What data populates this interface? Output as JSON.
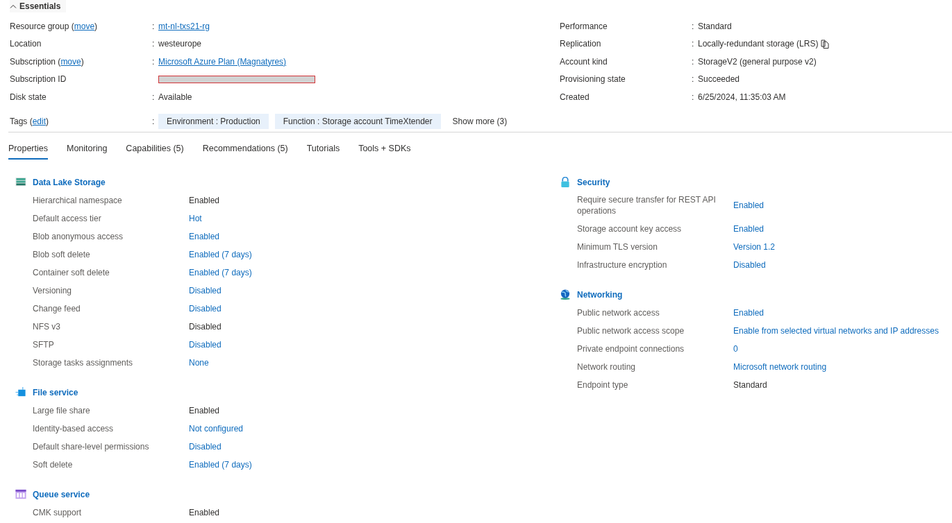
{
  "essentials": {
    "title": "Essentials",
    "expanded": true,
    "left": [
      {
        "label": "Resource group (",
        "label_link": "move",
        "label_after": ")",
        "separator": ":",
        "value": "mt-nl-txs21-rg",
        "link": true
      },
      {
        "label": "Location",
        "separator": ":",
        "value": "westeurope",
        "link": false
      },
      {
        "label": "Subscription (",
        "label_link": "move",
        "label_after": ")",
        "separator": ":",
        "value": "Microsoft Azure Plan (Magnatyres)",
        "link": true
      },
      {
        "label": "Subscription ID",
        "kind": "redacted"
      },
      {
        "label": "Disk state",
        "separator": ":",
        "value": "Available",
        "link": false
      }
    ],
    "right": [
      {
        "label": "Performance",
        "separator": ":",
        "value": "Standard",
        "link": false
      },
      {
        "label": "Replication",
        "separator": ":",
        "value": "Locally-redundant storage (LRS)",
        "link": false,
        "copyable": true
      },
      {
        "label": "Account kind",
        "separator": ":",
        "value": "StorageV2 (general purpose v2)",
        "link": false
      },
      {
        "label": "Provisioning state",
        "separator": ":",
        "value": "Succeeded",
        "link": false
      },
      {
        "label": "Created",
        "separator": ":",
        "value": "6/25/2024, 11:35:03 AM",
        "link": false
      }
    ],
    "tags": {
      "label": "Tags (",
      "label_link": "edit",
      "label_after": ")",
      "separator": ":",
      "items": [
        "Environment : Production",
        "Function : Storage account TimeXtender"
      ],
      "show_more": "Show more (3)"
    }
  },
  "tabs": [
    {
      "label": "Properties",
      "selected": true
    },
    {
      "label": "Monitoring",
      "selected": false
    },
    {
      "label": "Capabilities (5)",
      "selected": false
    },
    {
      "label": "Recommendations (5)",
      "selected": false
    },
    {
      "label": "Tutorials",
      "selected": false
    },
    {
      "label": "Tools + SDKs",
      "selected": false
    }
  ],
  "columns": [
    [
      {
        "title": "Data Lake Storage",
        "items": [
          {
            "label": "Hierarchical namespace",
            "value": "Enabled",
            "link": false
          },
          {
            "label": "Default access tier",
            "value": "Hot",
            "link": true
          },
          {
            "label": "Blob anonymous access",
            "value": "Enabled",
            "link": true
          },
          {
            "label": "Blob soft delete",
            "value": "Enabled (7 days)",
            "link": true
          },
          {
            "label": "Container soft delete",
            "value": "Enabled (7 days)",
            "link": true
          },
          {
            "label": "Versioning",
            "value": "Disabled",
            "link": true
          },
          {
            "label": "Change feed",
            "value": "Disabled",
            "link": true
          },
          {
            "label": "NFS v3",
            "value": "Disabled",
            "link": false
          },
          {
            "label": "SFTP",
            "value": "Disabled",
            "link": true
          },
          {
            "label": "Storage tasks assignments",
            "value": "None",
            "link": true
          }
        ]
      },
      {
        "title": "File service",
        "items": [
          {
            "label": "Large file share",
            "value": "Enabled",
            "link": false
          },
          {
            "label": "Identity-based access",
            "value": "Not configured",
            "link": true
          },
          {
            "label": "Default share-level permissions",
            "value": "Disabled",
            "link": true
          },
          {
            "label": "Soft delete",
            "value": "Enabled (7 days)",
            "link": true
          }
        ]
      },
      {
        "title": "Queue service",
        "items": [
          {
            "label": "CMK support",
            "value": "Enabled",
            "link": false
          }
        ]
      }
    ],
    [
      {
        "title": "Security",
        "items": [
          {
            "label": "Require secure transfer for REST API operations",
            "value": "Enabled",
            "link": true
          },
          {
            "label": "Storage account key access",
            "value": "Enabled",
            "link": true
          },
          {
            "label": "Minimum TLS version",
            "value": "Version 1.2",
            "link": true
          },
          {
            "label": "Infrastructure encryption",
            "value": "Disabled",
            "link": true
          }
        ]
      },
      {
        "title": "Networking",
        "items": [
          {
            "label": "Public network access",
            "value": "Enabled",
            "link": true
          },
          {
            "label": "Public network access scope",
            "value": "Enable from selected virtual networks and IP addresses",
            "link": true
          },
          {
            "label": "Private endpoint connections",
            "value": "0",
            "link": true
          },
          {
            "label": "Network routing",
            "value": "Microsoft network routing",
            "link": true
          },
          {
            "label": "Endpoint type",
            "value": "Standard",
            "link": false
          }
        ]
      }
    ]
  ]
}
